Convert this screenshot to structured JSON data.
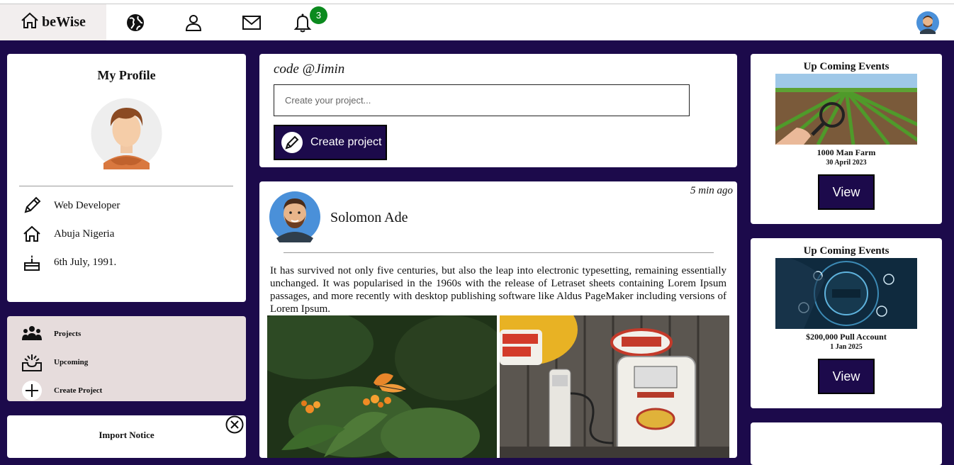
{
  "brand": {
    "label": "beWise",
    "icon": "home-icon"
  },
  "nav": {
    "icons": [
      "globe-icon",
      "user-icon",
      "mail-icon",
      "bell-icon"
    ],
    "notification_count": "3"
  },
  "profile": {
    "title": "My Profile",
    "details": [
      {
        "icon": "pencil-icon",
        "text": "Web Developer"
      },
      {
        "icon": "home-icon",
        "text": "Abuja Nigeria"
      },
      {
        "icon": "cake-icon",
        "text": "6th July, 1991."
      }
    ]
  },
  "menu": {
    "items": [
      {
        "icon": "group-icon",
        "label": "Projects"
      },
      {
        "icon": "inbox-icon",
        "label": "Upcoming"
      },
      {
        "icon": "plus-circle-icon",
        "label": "Create Project"
      }
    ]
  },
  "notice": {
    "title": "Import Notice"
  },
  "composer": {
    "user": "code @Jimin",
    "placeholder": "Create your project...",
    "button_label": "Create project"
  },
  "post": {
    "author": "Solomon Ade",
    "time": "5 min ago",
    "text": "It has survived not only five centuries, but also the leap into electronic typesetting, remaining essentially unchanged. It was popularised in the 1960s with the release of Letraset sheets containing Lorem Ipsum passages, and more recently with desktop publishing software like Aldus PageMaker including versions of Lorem Ipsum."
  },
  "events": [
    {
      "heading": "Up Coming Events",
      "name": "1000 Man Farm",
      "date": "30 April 2023",
      "button": "View"
    },
    {
      "heading": "Up Coming Events",
      "name": "$200,000 Pull Account",
      "date": "1 Jan 2025",
      "button": "View"
    }
  ],
  "colors": {
    "primary": "#1c0a4b",
    "badge": "#0b8a1e",
    "menu_bg": "#e6dcdc"
  }
}
